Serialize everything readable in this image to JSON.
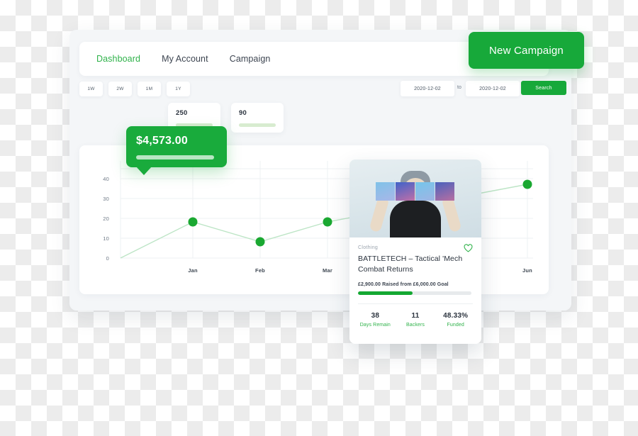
{
  "window": {
    "nav": {
      "items": [
        {
          "label": "Dashboard",
          "active": true
        },
        {
          "label": "My Account",
          "active": false
        },
        {
          "label": "Campaign",
          "active": false
        }
      ]
    },
    "new_campaign_label": "New Campaign",
    "filters": {
      "periods": [
        "1W",
        "2W",
        "1M",
        "1Y"
      ],
      "date_from": "2020-12-02",
      "date_to": "2020-12-02",
      "date_separator": "to",
      "search_label": "Search"
    },
    "tooltip": {
      "value": "$4,573.00"
    },
    "kpis": [
      {
        "value": "250"
      },
      {
        "value": "90"
      }
    ]
  },
  "chart_data": {
    "type": "line",
    "title": "",
    "xlabel": "",
    "ylabel": "",
    "categories": [
      "Jan",
      "Feb",
      "Mar",
      "Jun"
    ],
    "x_tick_labels": [
      "Jan",
      "Feb",
      "Mar",
      "Jun"
    ],
    "y_tick_labels": [
      "0",
      "10",
      "20",
      "30",
      "40"
    ],
    "values": [
      18,
      10,
      18,
      38
    ],
    "ylim": [
      0,
      45
    ],
    "grid": true,
    "legend": "none",
    "accent_color": "#1aa831",
    "line_color": "#bde5c6"
  },
  "campaign_card": {
    "category": "Clothing",
    "favorite_icon": "heart-icon",
    "title": "BATTLETECH – Tactical 'Mech Combat Returns",
    "funding_text": "£2,900.00 Raised from £6,000.00 Goal",
    "funding_percent": 48.33,
    "stats": [
      {
        "number": "38",
        "label": "Days Remain"
      },
      {
        "number": "11",
        "label": "Backers"
      },
      {
        "number": "48.33%",
        "label": "Funded"
      }
    ]
  },
  "colors": {
    "accent_green": "#17a93a",
    "dot_green": "#1aa831",
    "light_green": "#d8ecd0",
    "text_dark": "#2b333e",
    "bg": "#f4f6f8"
  }
}
